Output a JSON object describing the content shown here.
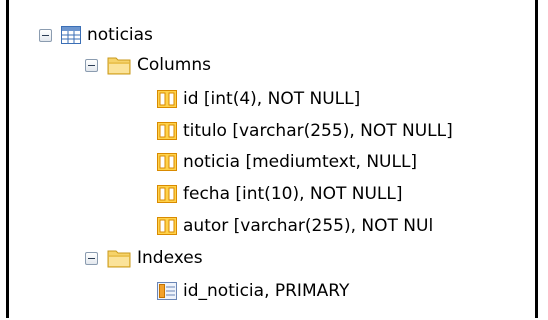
{
  "tree": {
    "table": {
      "name": "noticias",
      "icon": "table-icon"
    },
    "columns": {
      "label": "Columns",
      "icon": "folder-icon",
      "items": [
        {
          "label": "id [int(4), NOT NULL]",
          "icon": "column-icon"
        },
        {
          "label": "titulo [varchar(255), NOT NULL]",
          "icon": "column-icon"
        },
        {
          "label": "noticia [mediumtext, NULL]",
          "icon": "column-icon"
        },
        {
          "label": "fecha [int(10), NOT NULL]",
          "icon": "column-icon"
        },
        {
          "label": "autor [varchar(255), NOT NUl",
          "icon": "column-icon"
        }
      ]
    },
    "indexes": {
      "label": "Indexes",
      "icon": "folder-icon",
      "items": [
        {
          "label": "id_noticia, PRIMARY",
          "icon": "index-icon"
        }
      ]
    }
  },
  "colors": {
    "frame": "#000000",
    "column_icon": "#e8a000",
    "folder": "#f4c542",
    "table_icon": "#3b6fb6"
  }
}
